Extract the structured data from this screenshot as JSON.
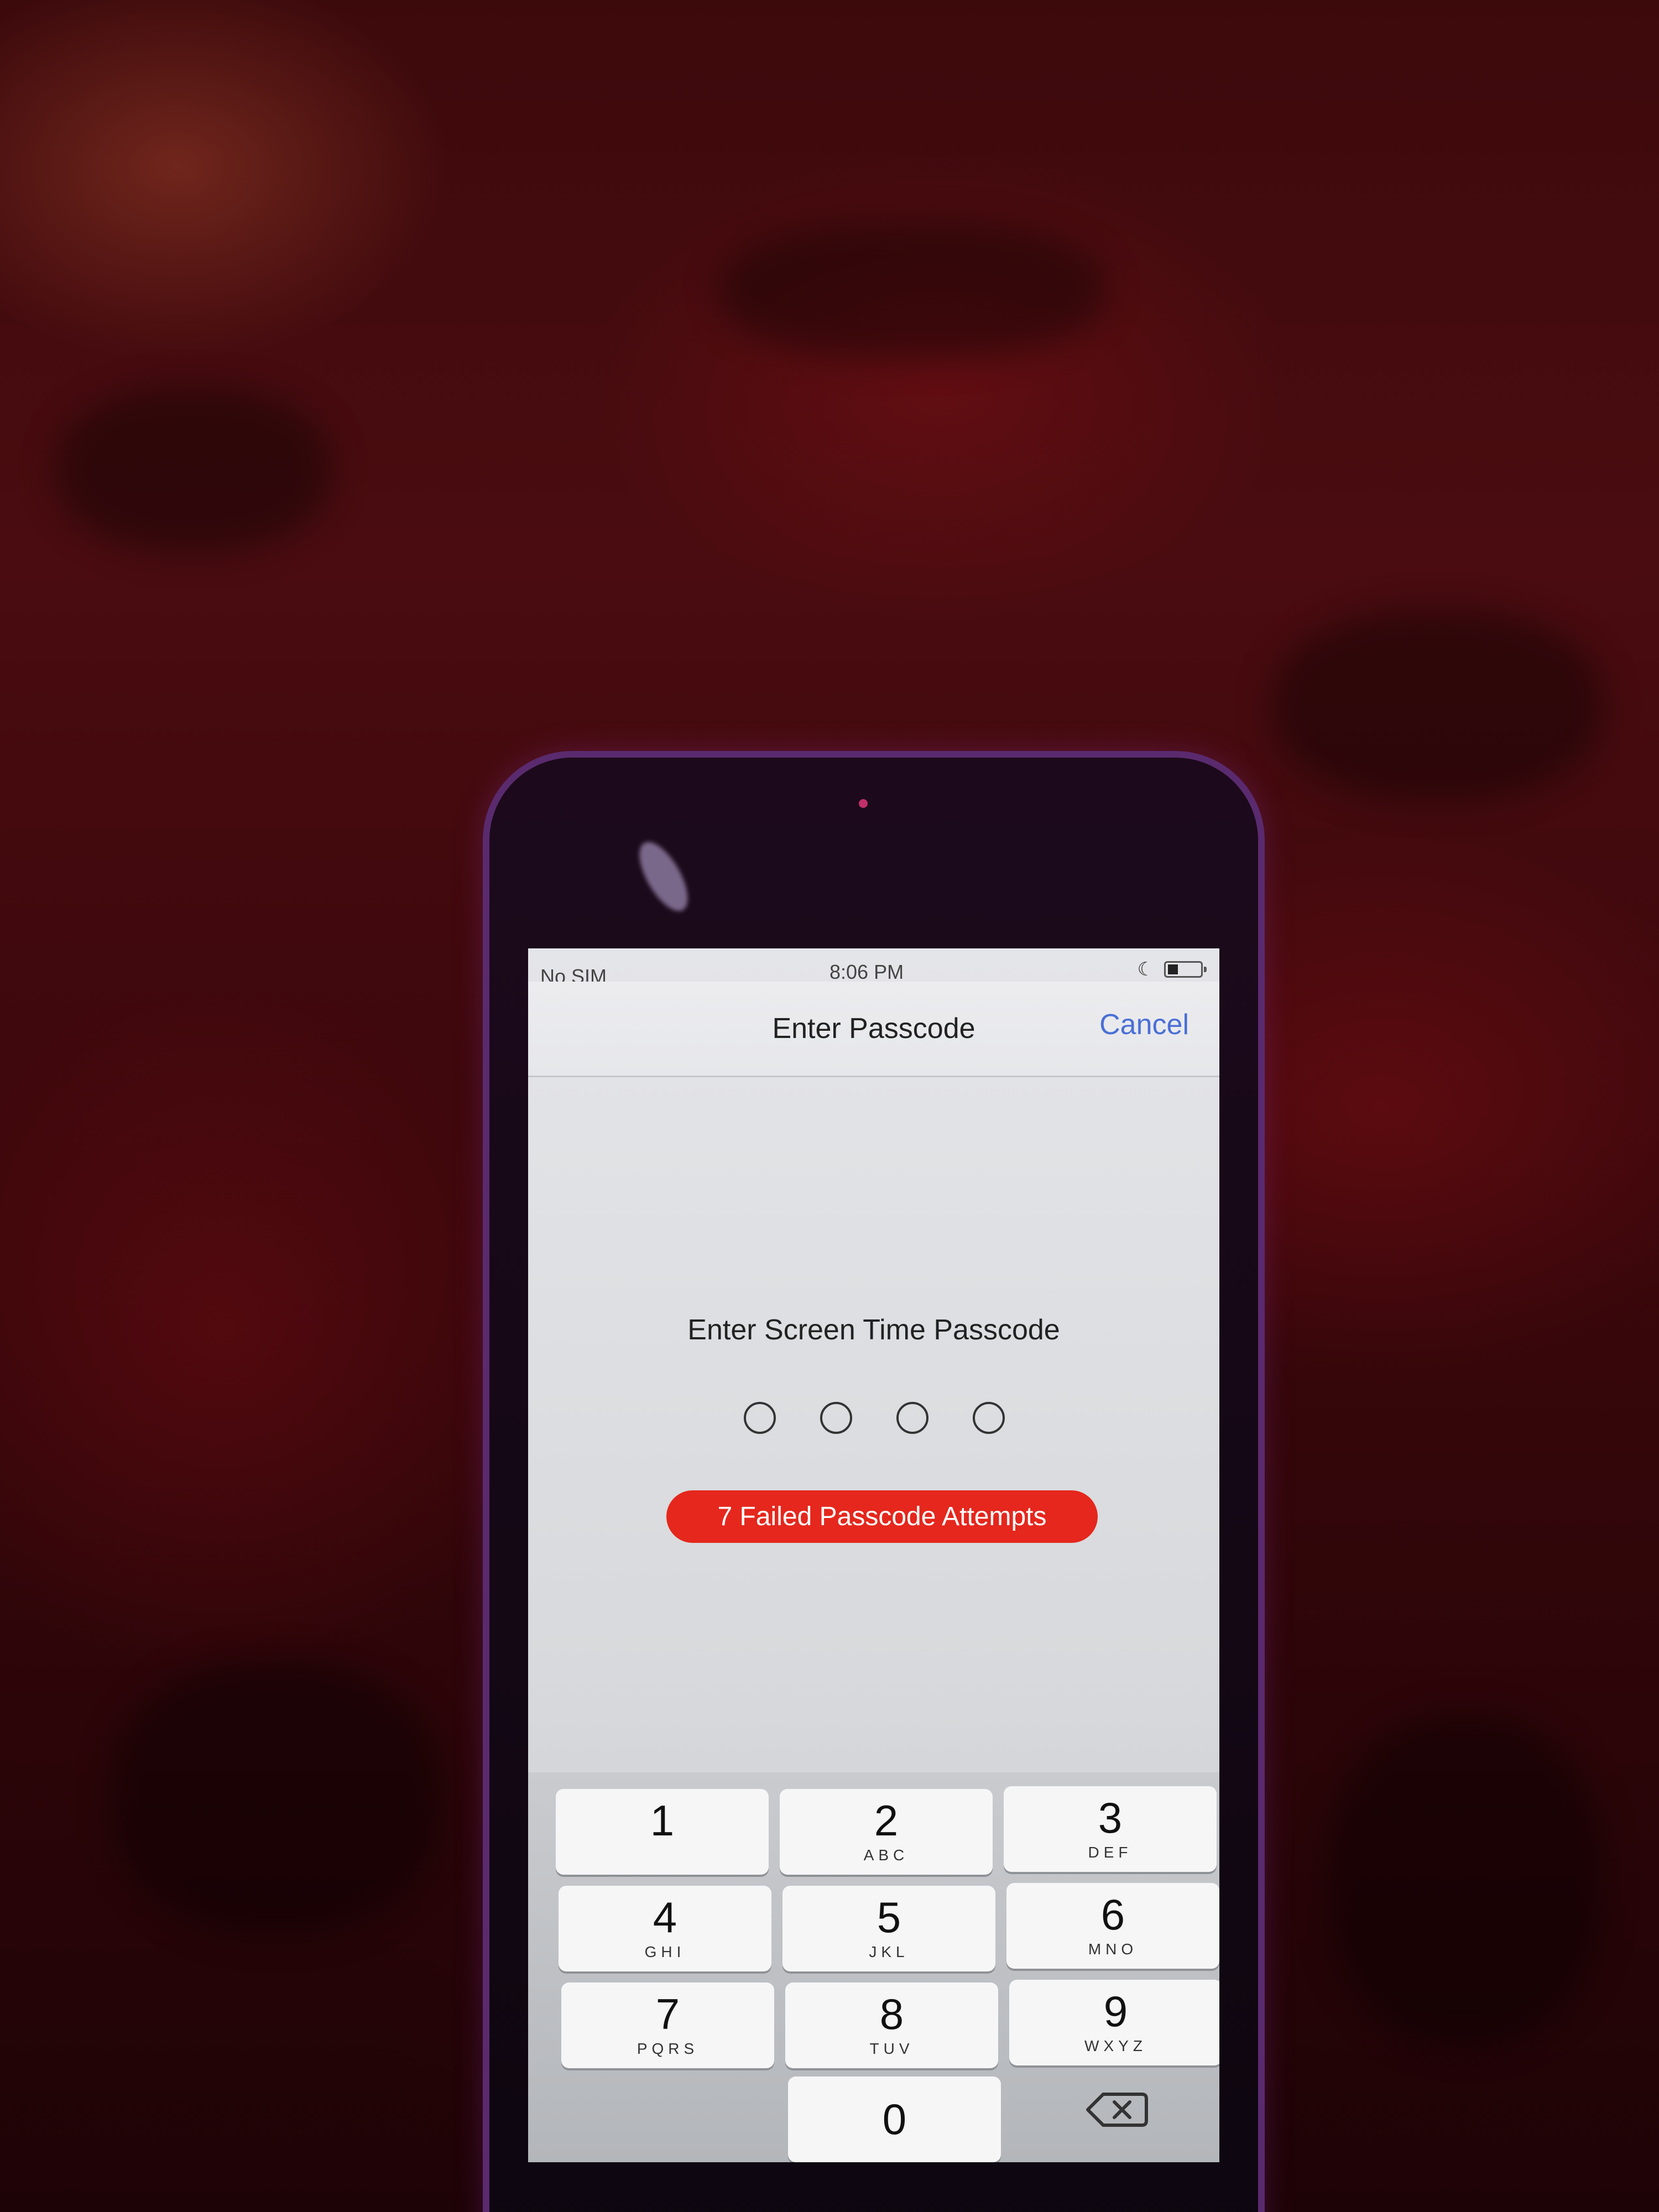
{
  "statusbar": {
    "carrier": "No SIM",
    "time": "8:06 PM",
    "icons": [
      "moon-icon",
      "battery-icon"
    ]
  },
  "navbar": {
    "title": "Enter Passcode",
    "cancel_label": "Cancel"
  },
  "passcode": {
    "prompt": "Enter Screen Time Passcode",
    "digits_total": 4,
    "digits_entered": 0,
    "failed_message": "7 Failed Passcode Attempts"
  },
  "keypad": {
    "keys": [
      {
        "digit": "1",
        "letters": ""
      },
      {
        "digit": "2",
        "letters": "ABC"
      },
      {
        "digit": "3",
        "letters": "DEF"
      },
      {
        "digit": "4",
        "letters": "GHI"
      },
      {
        "digit": "5",
        "letters": "JKL"
      },
      {
        "digit": "6",
        "letters": "MNO"
      },
      {
        "digit": "7",
        "letters": "PQRS"
      },
      {
        "digit": "8",
        "letters": "TUV"
      },
      {
        "digit": "9",
        "letters": "WXYZ"
      },
      {
        "digit": "0",
        "letters": ""
      }
    ],
    "delete_icon": "delete-backspace-icon"
  },
  "colors": {
    "accent": "#4a6fd6",
    "alert": "#e5271d"
  }
}
